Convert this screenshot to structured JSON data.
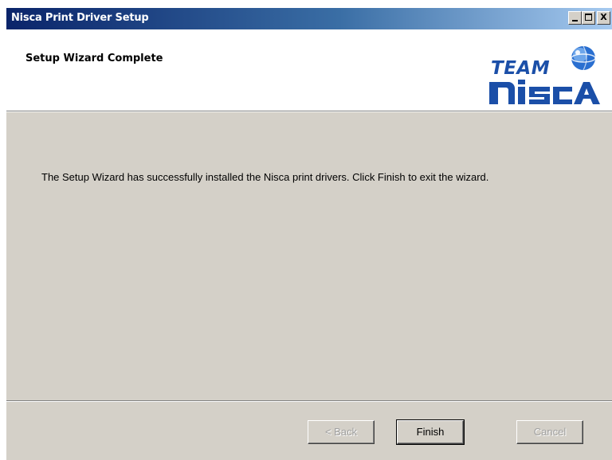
{
  "window": {
    "title": "Nisca Print Driver Setup",
    "caption_buttons": [
      "minimize",
      "maximize",
      "close"
    ],
    "close_label": "X"
  },
  "header": {
    "title": "Setup Wizard Complete",
    "logo": {
      "top_text": "TEAM",
      "bottom_text": "nisca",
      "icon": "globe-icon"
    }
  },
  "content": {
    "message": "The Setup Wizard has successfully installed the Nisca print drivers. Click Finish to exit the wizard."
  },
  "buttons": {
    "back": {
      "label": "< Back",
      "enabled": false
    },
    "finish": {
      "label": "Finish",
      "enabled": true,
      "default": true
    },
    "cancel": {
      "label": "Cancel",
      "enabled": false
    }
  },
  "colors": {
    "titlebar_start": "#0a246a",
    "titlebar_end": "#a6caf0",
    "dialog_face": "#d4d0c8",
    "logo_blue": "#1b4fa8"
  }
}
